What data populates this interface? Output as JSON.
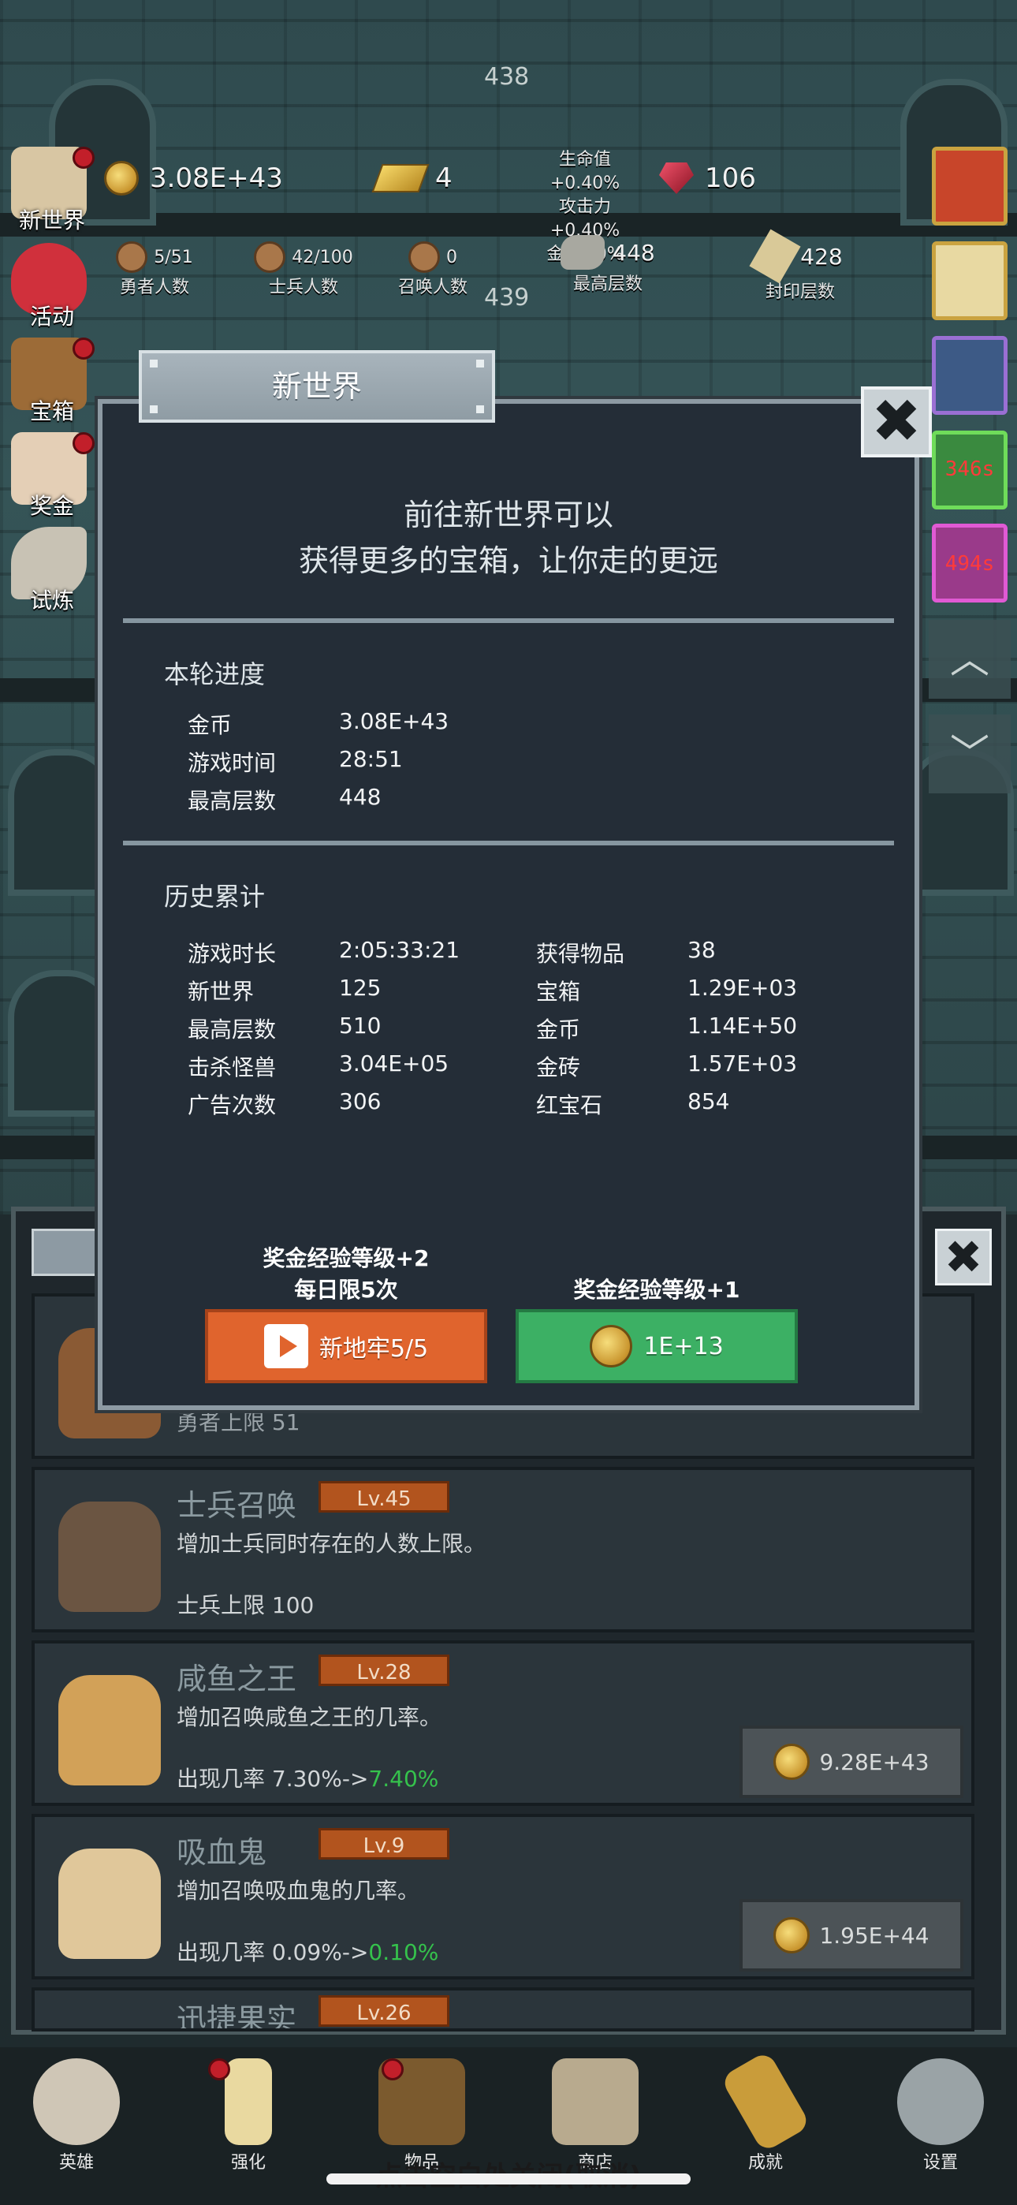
{
  "hud": {
    "gold": "3.08E+43",
    "gold_bars": "4",
    "rubies": "106",
    "buffs": [
      "生命值+0.40%",
      "攻击力+0.40%",
      "金币+0%"
    ],
    "hero_count": "5/51",
    "hero_label": "勇者人数",
    "soldier_count": "42/100",
    "soldier_label": "士兵人数",
    "summon_count": "0",
    "summon_label": "召唤人数",
    "max_floor": "448",
    "max_floor_label": "最高层数",
    "seal_floor": "428",
    "seal_floor_label": "封印层数",
    "floor_top": "438",
    "floor_mid": "439"
  },
  "side_menu": [
    "新世界",
    "活动",
    "宝箱",
    "奖金",
    "试炼"
  ],
  "right_timers": [
    "346s",
    "494s"
  ],
  "right_arrows": [
    "︿",
    "﹀"
  ],
  "modal": {
    "title": "新世界",
    "close": "✖",
    "intro_line1": "前往新世界可以",
    "intro_line2": "获得更多的宝箱，让你走的更远",
    "current": {
      "title": "本轮进度",
      "rows": [
        {
          "k": "金币",
          "v": "3.08E+43"
        },
        {
          "k": "游戏时间",
          "v": "28:51"
        },
        {
          "k": "最高层数",
          "v": "448"
        }
      ]
    },
    "history": {
      "title": "历史累计",
      "left": [
        {
          "k": "游戏时长",
          "v": "2:05:33:21"
        },
        {
          "k": "新世界",
          "v": "125"
        },
        {
          "k": "最高层数",
          "v": "510"
        },
        {
          "k": "击杀怪兽",
          "v": "3.04E+05"
        },
        {
          "k": "广告次数",
          "v": "306"
        }
      ],
      "right": [
        {
          "k": "获得物品",
          "v": "38"
        },
        {
          "k": "宝箱",
          "v": "1.29E+03"
        },
        {
          "k": "金币",
          "v": "1.14E+50"
        },
        {
          "k": "金砖",
          "v": "1.57E+03"
        },
        {
          "k": "红宝石",
          "v": "854"
        }
      ]
    },
    "reward_left_line1": "奖金经验等级+2",
    "reward_left_line2": "每日限5次",
    "reward_right": "奖金经验等级+1",
    "btn_video_label": "新地牢5/5",
    "btn_coin_label": "1E+13"
  },
  "list": {
    "partial_stat": "勇者上限 51",
    "cards": [
      {
        "name": "士兵召唤",
        "lv": "Lv.45",
        "desc": "增加士兵同时存在的人数上限。",
        "stat": "士兵上限 100",
        "stat_next": "",
        "cost": ""
      },
      {
        "name": "咸鱼之王",
        "lv": "Lv.28",
        "desc": "增加召唤咸鱼之王的几率。",
        "stat": "出现几率 7.30%->",
        "stat_next": "7.40%",
        "cost": "9.28E+43"
      },
      {
        "name": "吸血鬼",
        "lv": "Lv.9",
        "desc": "增加召唤吸血鬼的几率。",
        "stat": "出现几率 0.09%->",
        "stat_next": "0.10%",
        "cost": "1.95E+44"
      },
      {
        "name": "迅捷果实",
        "lv": "Lv.26",
        "desc": "",
        "stat": "",
        "stat_next": "",
        "cost": ""
      }
    ],
    "close": "✖"
  },
  "nav": [
    "英雄",
    "强化",
    "物品",
    "商店",
    "成就",
    "设置"
  ],
  "close_hint": "点击空白处关闭(取消)",
  "colors": {
    "accent_green": "#35c24c",
    "orange_btn": "#e0642d",
    "green_btn": "#3cb064",
    "level_badge": "#b2541e"
  }
}
